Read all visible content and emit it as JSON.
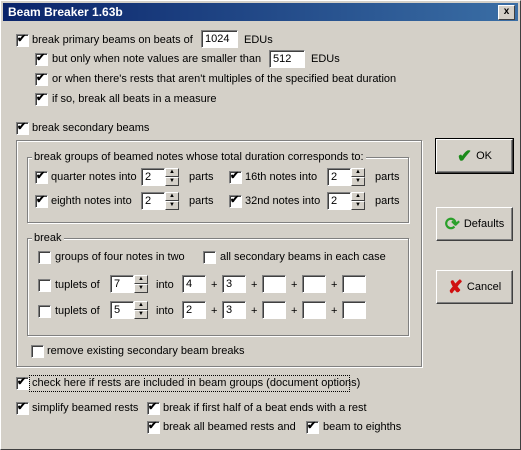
{
  "window": {
    "title": "Beam Breaker 1.63b",
    "close": "x"
  },
  "primary": {
    "label": "break primary beams on beats of",
    "value": "1024",
    "unit": "EDUs",
    "only_smaller_label": "but only when note values are smaller than",
    "only_smaller_value": "512",
    "only_smaller_unit": "EDUs",
    "rests_label": "or when there's rests that aren't multiples of the specified beat duration",
    "break_all_label": "if so, break all beats in a measure"
  },
  "secondary": {
    "label": "break secondary beams",
    "groups_title": "break groups of beamed notes whose total duration corresponds to:",
    "quarter_label": "quarter notes into",
    "quarter_value": "2",
    "quarter_unit": "parts",
    "eighth_label": "eighth notes into",
    "eighth_value": "2",
    "eighth_unit": "parts",
    "sixteenth_label": "16th notes into",
    "sixteenth_value": "2",
    "sixteenth_unit": "parts",
    "thirtysecond_label": "32nd notes into",
    "thirtysecond_value": "2",
    "thirtysecond_unit": "parts",
    "break_title": "break",
    "four_two_label": "groups of four notes in two",
    "all_secondary_label": "all secondary beams in each case",
    "tuplets1_label": "tuplets of",
    "tuplets1_value": "7",
    "into1": "into",
    "tuplets1_parts": [
      "4",
      "3",
      "",
      "",
      ""
    ],
    "tuplets2_label": "tuplets of",
    "tuplets2_value": "5",
    "into2": "into",
    "tuplets2_parts": [
      "2",
      "3",
      "",
      "",
      ""
    ],
    "plus": "+",
    "remove_label": "remove existing secondary beam breaks"
  },
  "rests": {
    "include_label": "check here if rests are included in beam groups (document options)",
    "simplify_label": "simplify beamed rests",
    "first_half_label": "break if first half of a beat ends with a rest",
    "break_all_rests_label": "break all beamed rests and",
    "beam_eighths_label": "beam to eighths"
  },
  "buttons": {
    "ok": "OK",
    "defaults": "Defaults",
    "cancel": "Cancel"
  },
  "icons": {
    "ok": "checkmark-icon",
    "defaults": "refresh-icon",
    "cancel": "x-icon"
  },
  "colors": {
    "title_start": "#0a246a",
    "title_end": "#3a6ea5",
    "face": "#d4d0c8"
  }
}
